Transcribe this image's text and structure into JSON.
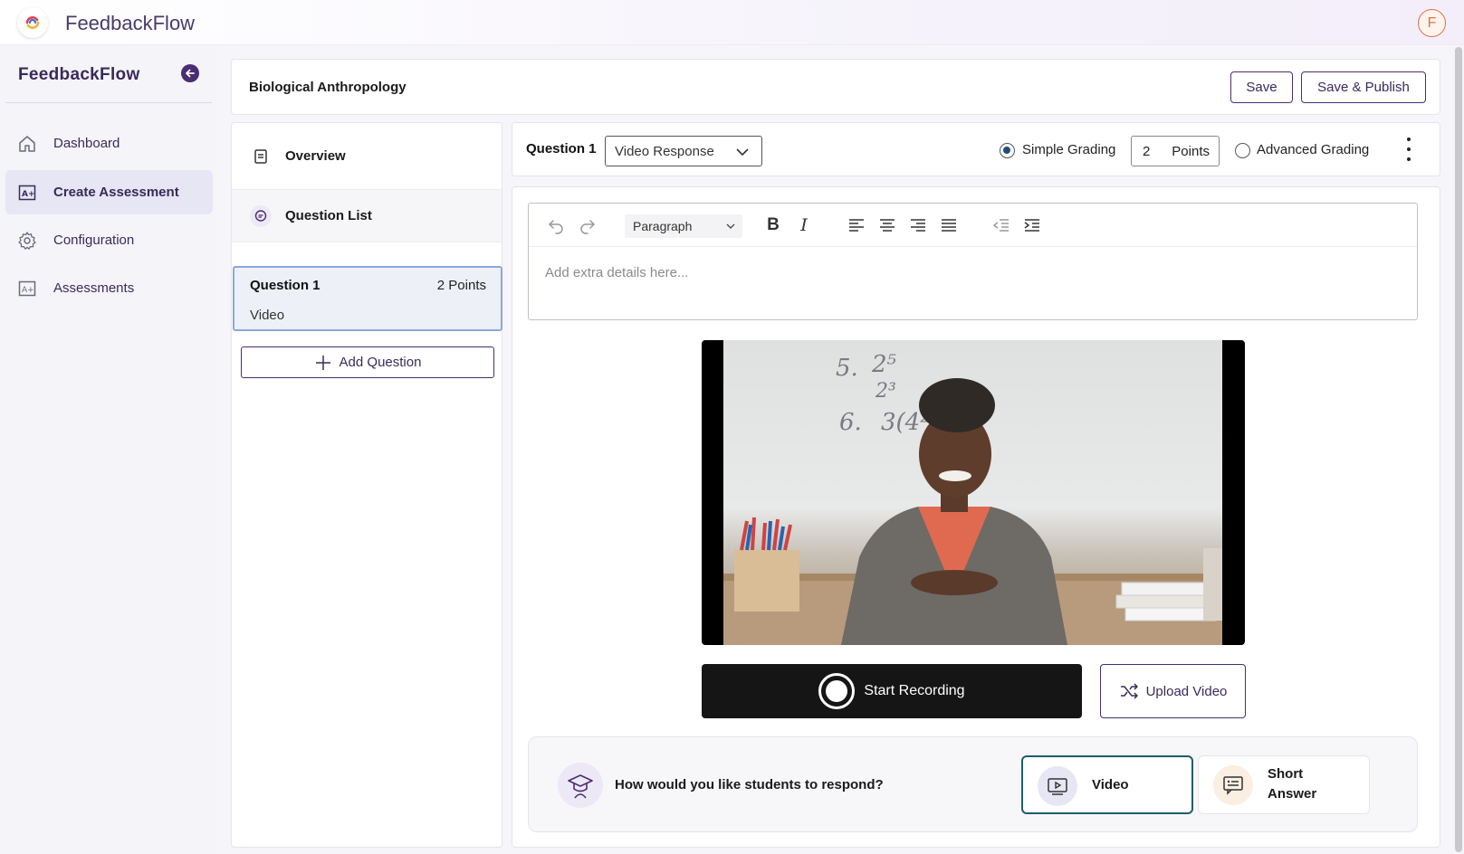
{
  "app": {
    "title": "FeedbackFlow",
    "user_initial": "F"
  },
  "sidebar": {
    "brand": "FeedbackFlow",
    "items": [
      {
        "label": "Dashboard",
        "icon": "home-icon",
        "active": false
      },
      {
        "label": "Create Assessment",
        "icon": "grade-icon",
        "active": true
      },
      {
        "label": "Configuration",
        "icon": "gear-icon",
        "active": false
      },
      {
        "label": "Assessments",
        "icon": "grade-icon",
        "active": false
      }
    ]
  },
  "header": {
    "course_title": "Biological Anthropology",
    "save_label": "Save",
    "publish_label": "Save & Publish"
  },
  "question_panel": {
    "overview_label": "Overview",
    "question_list_label": "Question List",
    "questions": [
      {
        "title": "Question 1",
        "points": "2 Points",
        "type": "Video"
      }
    ],
    "add_question_label": "Add Question"
  },
  "question_toolbar": {
    "label": "Question 1",
    "type_selected": "Video Response",
    "simple_grading_label": "Simple Grading",
    "simple_grading_selected": true,
    "points_value": "2",
    "points_unit": "Points",
    "advanced_grading_label": "Advanced Grading",
    "advanced_grading_selected": false
  },
  "editor": {
    "block_format": "Paragraph",
    "placeholder": "Add extra details here..."
  },
  "video": {
    "board_lines": [
      "5.",
      "2⁵",
      "2³",
      "6.",
      "3(4² +"
    ],
    "record_label": "Start Recording",
    "upload_label": "Upload Video"
  },
  "response": {
    "question": "How would you like students to respond?",
    "options": [
      {
        "label": "Video",
        "selected": true
      },
      {
        "label": "Short Answer",
        "selected": false
      }
    ]
  },
  "colors": {
    "brand": "#4a2d72",
    "accent_teal": "#1f5d6a",
    "card_selected_border": "#8aa7de",
    "record_bg": "#151516",
    "avatar": "#e0734a"
  }
}
